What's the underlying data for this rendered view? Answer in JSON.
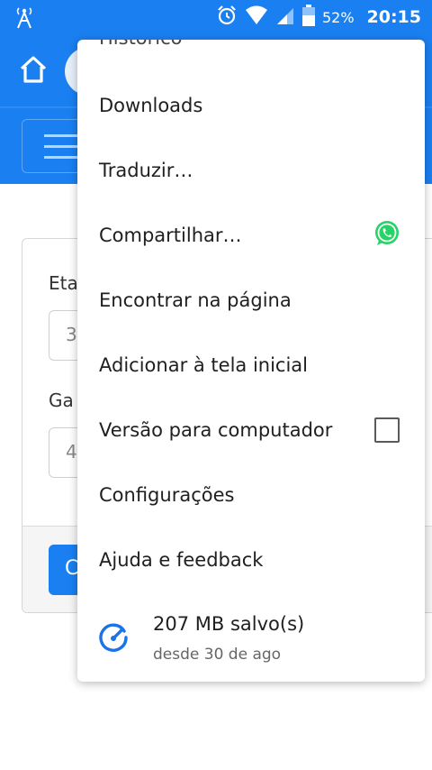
{
  "status_bar": {
    "battery_percent": "52%",
    "time": "20:15"
  },
  "colors": {
    "brand_blue": "#1a7ff0",
    "whatsapp_green": "#25d366",
    "savings_blue": "#1a73e8"
  },
  "background_page": {
    "label_1": "Eta",
    "input_1": "3",
    "label_2": "Ga",
    "input_2": "4",
    "button_label": "C"
  },
  "menu": {
    "cut_item": "Histórico",
    "items": [
      {
        "label": "Downloads"
      },
      {
        "label": "Traduzir…"
      },
      {
        "label": "Compartilhar…",
        "icon": "whatsapp-icon"
      },
      {
        "label": "Encontrar na página"
      },
      {
        "label": "Adicionar à tela inicial"
      },
      {
        "label": "Versão para computador",
        "checkbox": false
      },
      {
        "label": "Configurações"
      },
      {
        "label": "Ajuda e feedback"
      }
    ],
    "savings": {
      "title": "207 MB salvo(s)",
      "subtitle": "desde 30 de ago",
      "icon": "speedometer-icon"
    }
  }
}
